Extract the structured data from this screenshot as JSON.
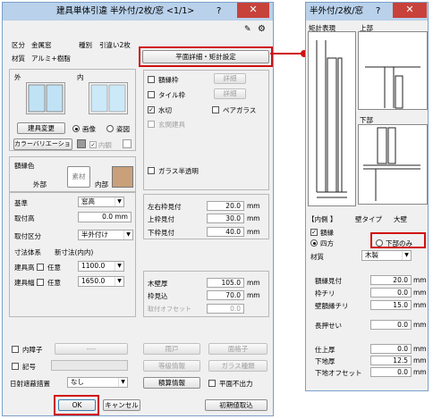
{
  "main_dialog": {
    "title": "建具単体引違 半外付/2枚/窓 <1/1>",
    "close": "✕",
    "class_label": "区分",
    "class_value": "金属窓",
    "type_label": "種別",
    "type_value": "引違い2枚",
    "material_label": "材質",
    "material_value": "アルミ+樹脂",
    "plan_detail_button": "平面詳細・矩計設定",
    "outside_label": "外",
    "inside_label": "内",
    "fixture_change_button": "建具変更",
    "radio_image": "画像",
    "radio_elevation": "姿図",
    "color_variation_button": "カラーバリエーション",
    "inner_label": "内観",
    "options": {
      "sill_frame": "額縁枠",
      "tile_frame": "タイル枠",
      "water_cut": "水切",
      "entrance": "玄関建具",
      "pair_glass": "ペアガラス",
      "detail": "詳細",
      "glass_opaque": "ガラス半透明"
    },
    "frame_color_label": "額縁色",
    "wood_label": "素材",
    "outer_label": "外部",
    "interior_label": "内部",
    "base_label": "基準",
    "base_value": "窓高",
    "mount_height_label": "取付高",
    "mount_height_value": "0.0 mm",
    "mount_class_label": "取付区分",
    "mount_class_value": "半外付け",
    "dim_system_label": "寸法体系",
    "dim_system_value": "新寸法(内内)",
    "fixture_height_label": "建具高",
    "fixture_width_label": "建具幅",
    "arbitrary": "任意",
    "height_value": "1100.0",
    "width_value": "1650.0",
    "lr_frame_label": "左右枠見付",
    "lr_frame_value": "20.0",
    "top_frame_label": "上枠見付",
    "top_frame_value": "30.0",
    "bottom_frame_label": "下枠見付",
    "bottom_frame_value": "40.0",
    "wall_thick_label": "木壁厚",
    "wall_thick_value": "105.0",
    "frame_depth_label": "枠見込",
    "frame_depth_value": "70.0",
    "mount_offset_label": "取付オフセット",
    "mount_offset_value": "0.0",
    "unit_mm": "mm",
    "inner_shoji_label": "内障子",
    "inner_shoji_value": "----",
    "symbol_label": "記号",
    "sunshade_label": "日射遮蔽措置",
    "sunshade_value": "なし",
    "rain_door_button": "雨戸",
    "face_lattice_button": "面格子",
    "equiv_info_button": "等級情報",
    "glass_type_button": "ガラス種類",
    "quantity_info_button": "積算情報",
    "plan_no_output": "平面不出力",
    "ok_button": "OK",
    "cancel_button": "キャンセル",
    "initial_button": "初期値取込"
  },
  "sub_dialog": {
    "title": "半外付/2枚/窓",
    "close": "✕",
    "section_label": "矩計表現",
    "top_label": "上部",
    "bottom_label": "下部",
    "inner_header": "【内側 】",
    "wall_type": "壁タイプ",
    "wall_value": "大壁",
    "frame_label": "額縁",
    "four_sides": "四方",
    "bottom_only": "下部のみ",
    "material_label": "材質",
    "material_value": "木製",
    "sill_width_label": "額縁見付",
    "sill_width_value": "20.0",
    "frame_chiri_label": "枠チリ",
    "frame_chiri_value": "0.0",
    "wall_chiri_label": "壁額縁チリ",
    "wall_chiri_value": "15.0",
    "long_label": "長押せい",
    "long_value": "0.0",
    "finish_thick_label": "仕上厚",
    "finish_thick_value": "0.0",
    "under_thick_label": "下地厚",
    "under_thick_value": "12.5",
    "under_offset_label": "下地オフセット",
    "under_offset_value": "0.0",
    "unit_mm": "mm"
  },
  "colors": {
    "highlight": "#d01010",
    "titlebar": "#b9d1ea",
    "close": "#c7423a",
    "wood": "#c9a07a"
  }
}
